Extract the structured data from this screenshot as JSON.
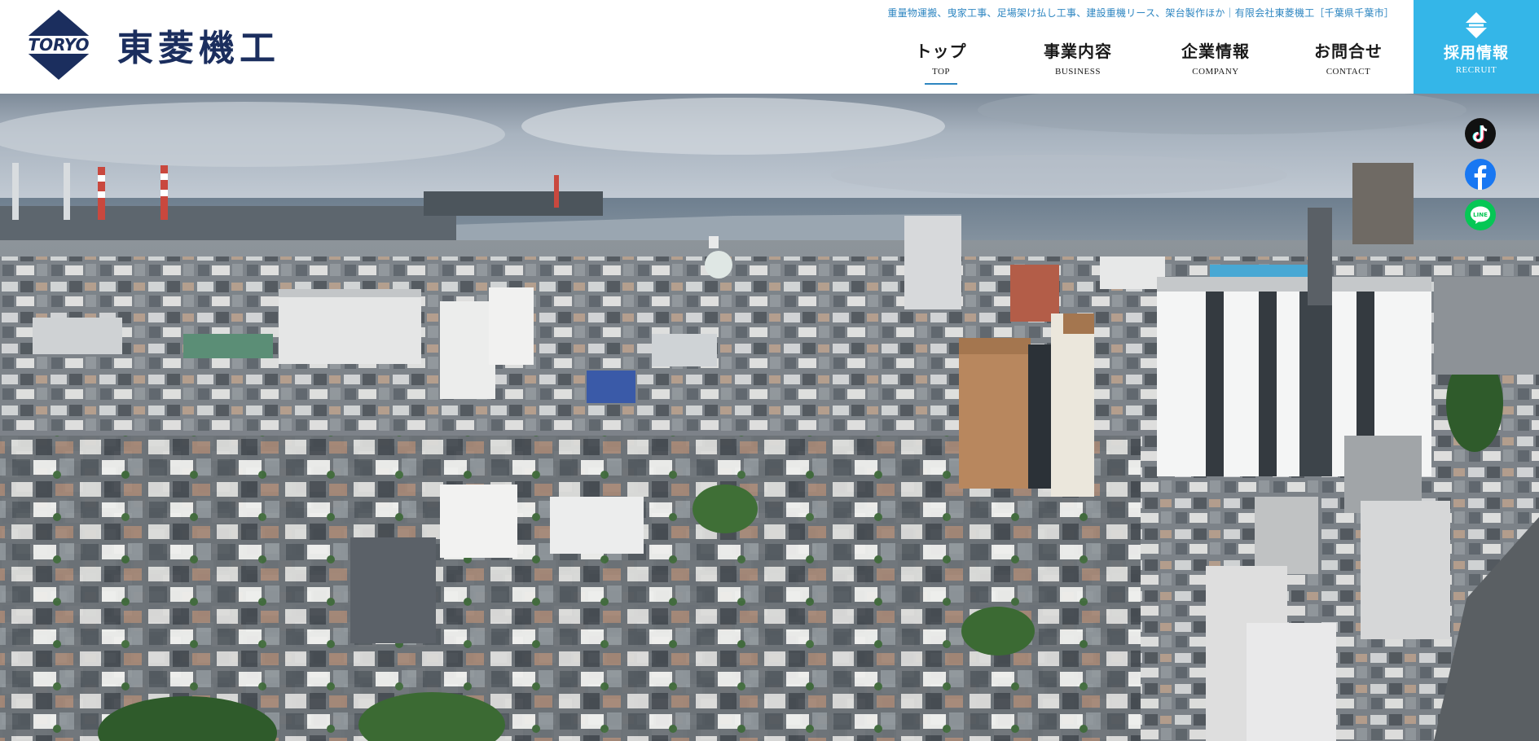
{
  "header": {
    "tagline": "重量物運搬、曳家工事、足場架け払し工事、建設重機リース、架台製作ほか｜有限会社東菱機工［千葉県千葉市］",
    "logo": {
      "emblem_text": "TORYO",
      "company_name": "東菱機工"
    },
    "colors": {
      "brand_navy": "#1b2e5e",
      "accent_blue": "#2e86c1",
      "recruit_bg": "#34b6e8"
    }
  },
  "nav": {
    "items": [
      {
        "ja": "トップ",
        "en": "TOP",
        "active": true
      },
      {
        "ja": "事業内容",
        "en": "BUSINESS",
        "active": false
      },
      {
        "ja": "企業情報",
        "en": "COMPANY",
        "active": false
      },
      {
        "ja": "お問合せ",
        "en": "CONTACT",
        "active": false
      }
    ],
    "recruit": {
      "ja": "採用情報",
      "en": "RECRUIT",
      "icon": "diamond-logo-icon"
    }
  },
  "hero": {
    "description_icon": "hero-image"
  },
  "social": [
    {
      "name": "tiktok",
      "icon": "tiktok-icon",
      "color": "#000000"
    },
    {
      "name": "facebook",
      "icon": "facebook-icon",
      "color": "#1877f2"
    },
    {
      "name": "line",
      "icon": "line-icon",
      "color": "#06c755"
    }
  ]
}
